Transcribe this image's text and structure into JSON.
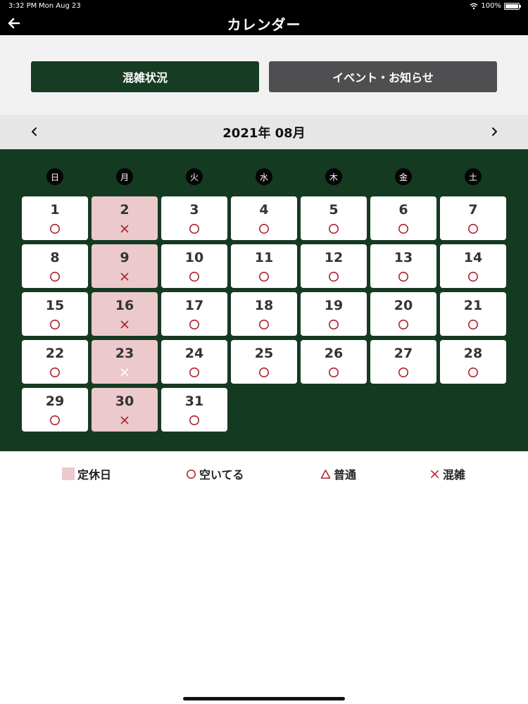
{
  "status_bar": {
    "time": "3:32 PM",
    "date": "Mon Aug 23",
    "battery": "100%",
    "battery_level": 1.0,
    "icons": [
      "wifi-icon",
      "battery-icon"
    ]
  },
  "nav": {
    "title": "カレンダー",
    "back_icon": "back-arrow-icon"
  },
  "tabs": [
    {
      "label": "混雑状況",
      "active": true
    },
    {
      "label": "イベント・お知らせ",
      "active": false
    }
  ],
  "month": {
    "title": "2021年 08月",
    "prev_icon": "chevron-left-icon",
    "next_icon": "chevron-right-icon"
  },
  "weekdays": [
    "日",
    "月",
    "火",
    "水",
    "木",
    "金",
    "土"
  ],
  "days": [
    {
      "day": "1",
      "mark": "circle",
      "closed": false
    },
    {
      "day": "2",
      "mark": "cross",
      "closed": true
    },
    {
      "day": "3",
      "mark": "circle",
      "closed": false
    },
    {
      "day": "4",
      "mark": "circle",
      "closed": false
    },
    {
      "day": "5",
      "mark": "circle",
      "closed": false
    },
    {
      "day": "6",
      "mark": "circle",
      "closed": false
    },
    {
      "day": "7",
      "mark": "circle",
      "closed": false
    },
    {
      "day": "8",
      "mark": "circle",
      "closed": false
    },
    {
      "day": "9",
      "mark": "cross",
      "closed": true
    },
    {
      "day": "10",
      "mark": "circle",
      "closed": false
    },
    {
      "day": "11",
      "mark": "circle",
      "closed": false
    },
    {
      "day": "12",
      "mark": "circle",
      "closed": false
    },
    {
      "day": "13",
      "mark": "circle",
      "closed": false
    },
    {
      "day": "14",
      "mark": "circle",
      "closed": false
    },
    {
      "day": "15",
      "mark": "circle",
      "closed": false
    },
    {
      "day": "16",
      "mark": "cross",
      "closed": true
    },
    {
      "day": "17",
      "mark": "circle",
      "closed": false
    },
    {
      "day": "18",
      "mark": "circle",
      "closed": false
    },
    {
      "day": "19",
      "mark": "circle",
      "closed": false
    },
    {
      "day": "20",
      "mark": "circle",
      "closed": false
    },
    {
      "day": "21",
      "mark": "circle",
      "closed": false
    },
    {
      "day": "22",
      "mark": "circle",
      "closed": false
    },
    {
      "day": "23",
      "mark": "cross-white",
      "closed": true
    },
    {
      "day": "24",
      "mark": "circle",
      "closed": false
    },
    {
      "day": "25",
      "mark": "circle",
      "closed": false
    },
    {
      "day": "26",
      "mark": "circle",
      "closed": false
    },
    {
      "day": "27",
      "mark": "circle",
      "closed": false
    },
    {
      "day": "28",
      "mark": "circle",
      "closed": false
    },
    {
      "day": "29",
      "mark": "circle",
      "closed": false
    },
    {
      "day": "30",
      "mark": "cross",
      "closed": true
    },
    {
      "day": "31",
      "mark": "circle",
      "closed": false
    }
  ],
  "legend": {
    "closed": "定休日",
    "vacant": "空いてる",
    "normal": "普通",
    "crowded": "混雑"
  },
  "colors": {
    "brand_green": "#163d24",
    "calendar_bg": "#153a22",
    "closed_day": "#ecc9cd",
    "mark_red": "#b0202c",
    "inactive_tab": "#4f4f51"
  }
}
